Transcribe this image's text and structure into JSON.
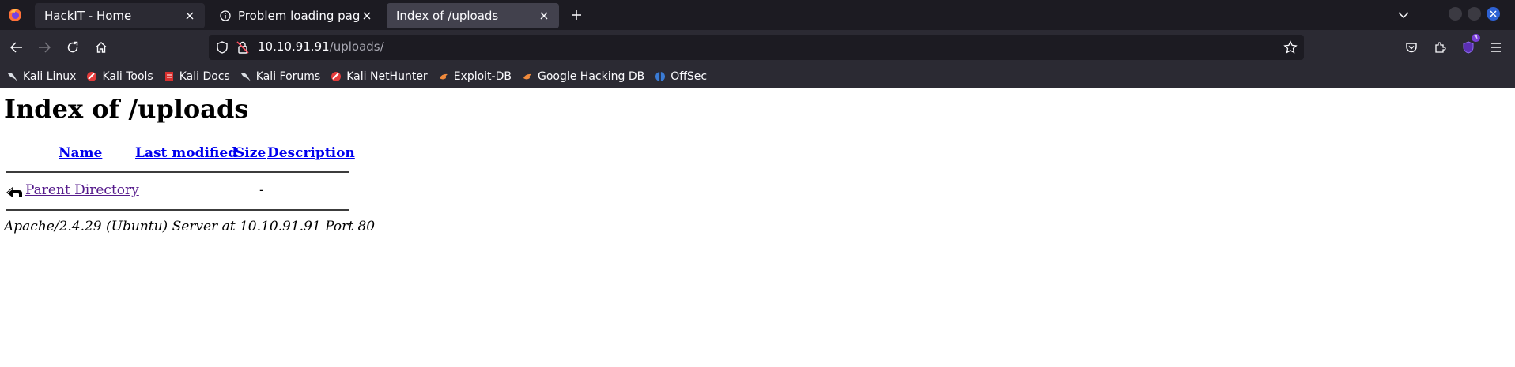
{
  "tabs": [
    {
      "title": "HackIT - Home",
      "active": false
    },
    {
      "title": "Problem loading page",
      "active": false
    },
    {
      "title": "Index of /uploads",
      "active": true
    }
  ],
  "url": {
    "host": "10.10.91.91",
    "path": "/uploads/"
  },
  "extension_badge": "3",
  "bookmarks": [
    {
      "label": "Kali Linux",
      "icon": "kali-dragon-icon"
    },
    {
      "label": "Kali Tools",
      "icon": "kali-tools-icon"
    },
    {
      "label": "Kali Docs",
      "icon": "kali-docs-icon"
    },
    {
      "label": "Kali Forums",
      "icon": "kali-dragon-icon"
    },
    {
      "label": "Kali NetHunter",
      "icon": "kali-tools-icon"
    },
    {
      "label": "Exploit-DB",
      "icon": "exploit-db-icon"
    },
    {
      "label": "Google Hacking DB",
      "icon": "exploit-db-icon"
    },
    {
      "label": "OffSec",
      "icon": "offsec-icon"
    }
  ],
  "page": {
    "heading": "Index of /uploads",
    "columns": {
      "name": "Name",
      "last_modified": "Last modified",
      "size": "Size",
      "description": "Description"
    },
    "rows": [
      {
        "name": "Parent Directory",
        "last_modified": "",
        "size": "-",
        "description": ""
      }
    ],
    "address": "Apache/2.4.29 (Ubuntu) Server at 10.10.91.91 Port 80"
  },
  "colors": {
    "chrome_dark": "#1c1b22",
    "toolbar": "#2b2a33",
    "active_tab": "#42414d",
    "link": "#0000ee",
    "visited_link": "#551a8b"
  }
}
